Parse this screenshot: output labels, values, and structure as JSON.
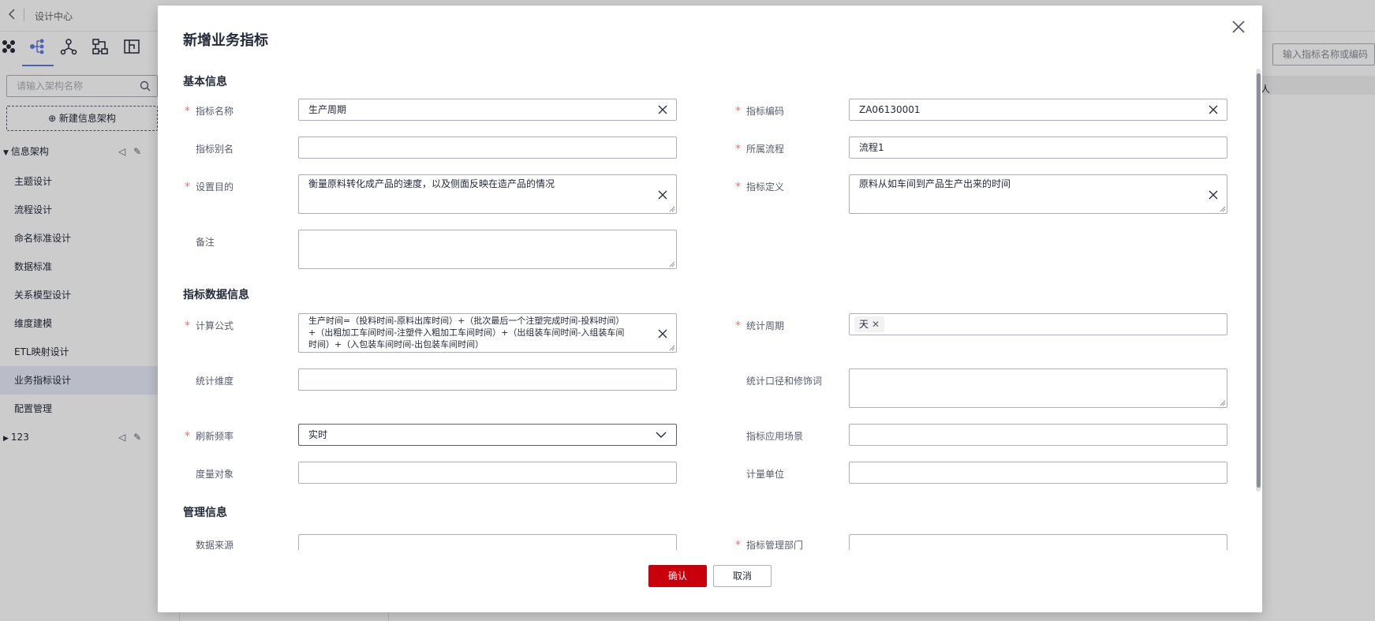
{
  "app": {
    "back_label": "<",
    "breadcrumb": "设计中心",
    "left_search_placeholder": "请输入架构名称",
    "new_arch_button": "⊕ 新建信息架构",
    "tree": {
      "root_label": "信息架构",
      "items": [
        "主题设计",
        "流程设计",
        "命名标准设计",
        "数据标准",
        "关系模型设计",
        "维度建模",
        "ETL映射设计",
        "业务指标设计",
        "配置管理"
      ],
      "active_index": 7,
      "second_root_label": "123"
    },
    "right_search_placeholder": "输入指标名称或编码",
    "table_header_fragment": "人"
  },
  "modal": {
    "title": "新增业务指标",
    "sections": {
      "basic": "基本信息",
      "data": "指标数据信息",
      "management": "管理信息"
    },
    "fields": {
      "name": {
        "label": "指标名称",
        "value": "生产周期",
        "required": true
      },
      "code": {
        "label": "指标编码",
        "value": "ZA06130001",
        "required": true
      },
      "alias": {
        "label": "指标别名",
        "value": "",
        "required": false
      },
      "process": {
        "label": "所属流程",
        "value": "流程1",
        "required": true
      },
      "purpose": {
        "label": "设置目的",
        "value": "衡量原料转化成产品的速度，以及侧面反映在造产品的情况",
        "required": true
      },
      "definition": {
        "label": "指标定义",
        "value": "原料从如车间到产品生产出来的时间",
        "required": true
      },
      "remark": {
        "label": "备注",
        "value": "",
        "required": false
      },
      "formula": {
        "label": "计算公式",
        "value_line1": "生产时间=（投料时间-原料出库时间）+（批次最后一个注塑完成时间-投料时间）",
        "value_line2": "+（出粗加工车间时间-注塑件入粗加工车间时间）+（出组装车间时间-入组装车间",
        "value_line3": "时间）+（入包装车间时间-出包装车间时间）",
        "required": true
      },
      "period": {
        "label": "统计周期",
        "tag": "天",
        "required": true
      },
      "dimension": {
        "label": "统计维度",
        "value": "",
        "required": false
      },
      "caliber": {
        "label": "统计口径和修饰词",
        "value": "",
        "required": false
      },
      "refresh": {
        "label": "刷新频率",
        "value": "实时",
        "required": true
      },
      "scenario": {
        "label": "指标应用场景",
        "value": "",
        "required": false
      },
      "measure": {
        "label": "度量对象",
        "value": "",
        "required": false
      },
      "unit": {
        "label": "计量单位",
        "value": "",
        "required": false
      },
      "source": {
        "label": "数据来源",
        "value": ""
      },
      "dept": {
        "label": "指标管理部门",
        "value": ""
      }
    },
    "confirm_label": "确认",
    "cancel_label": "取消"
  },
  "colors": {
    "primary": "#c7000b",
    "required_star": "#f66f6a",
    "accent_blue": "#5e7ce0",
    "active_nav_bg": "#e9edfa"
  }
}
